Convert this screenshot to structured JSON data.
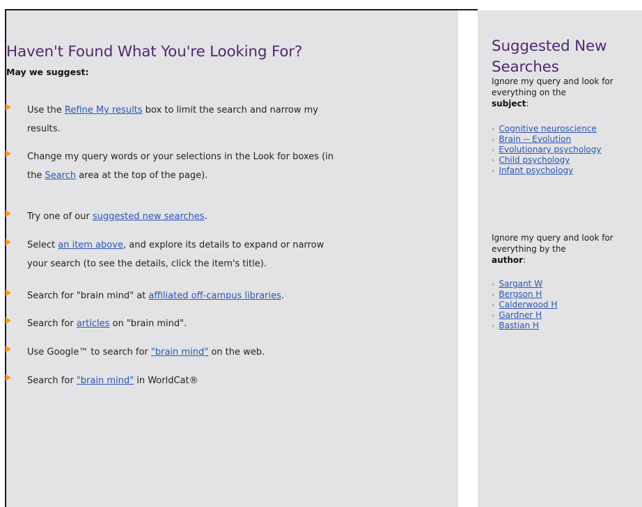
{
  "main": {
    "title": "Haven't Found What You're Looking For?",
    "subhead": "May we suggest:",
    "items": [
      {
        "pre": "Use the ",
        "link": "Refine My results",
        "post": " box to limit the search and narrow my",
        "line2": "results."
      },
      {
        "pre": "Change my query words or your selections in the Look for boxes (in",
        "line2_pre": "the ",
        "line2_link": "Search",
        "line2_post": " area at the top of the page)."
      },
      {
        "pre": "Try one of our ",
        "link": "suggested new searches",
        "post": "."
      },
      {
        "pre": "Select ",
        "link": "an item above",
        "post": ", and explore its details to expand or narrow",
        "line2": "your search (to see the details, click the item's title)."
      },
      {
        "pre": "Search for \"brain mind\" at ",
        "link": "affiliated off-campus libraries",
        "post": "."
      },
      {
        "pre": "Search for ",
        "link": "articles",
        "post": " on \"brain mind\"."
      },
      {
        "pre": "Use Google™ to search for ",
        "link": "\"brain mind\"",
        "post": " on the web."
      },
      {
        "pre": "Search for ",
        "link": "\"brain mind\"",
        "post": " in WorldCat®"
      }
    ]
  },
  "side": {
    "title": "Suggested New Searches",
    "subject_intro": "Ignore my query and look for everything on the",
    "subject_label": "subject",
    "subject_colon": ":",
    "subjects": [
      "Cognitive neuroscience",
      "Brain -- Evolution",
      "Evolutionary psychology",
      "Child psychology",
      "Infant psychology"
    ],
    "author_intro": "Ignore my query and look for everything by the",
    "author_label": "author",
    "author_colon": ":",
    "authors": [
      "Sargant W",
      "Bergson H",
      "Calderwood H",
      "Gardner H",
      "Bastian H"
    ]
  },
  "colors": {
    "panel_bg": "#e3e3e5",
    "title": "#4e2a6e",
    "link": "#2a55b3",
    "bullet": "#f0a020"
  },
  "icons": {
    "bullet": "orange-arrow-bullet-icon",
    "chevron": "chevron-right-icon"
  }
}
